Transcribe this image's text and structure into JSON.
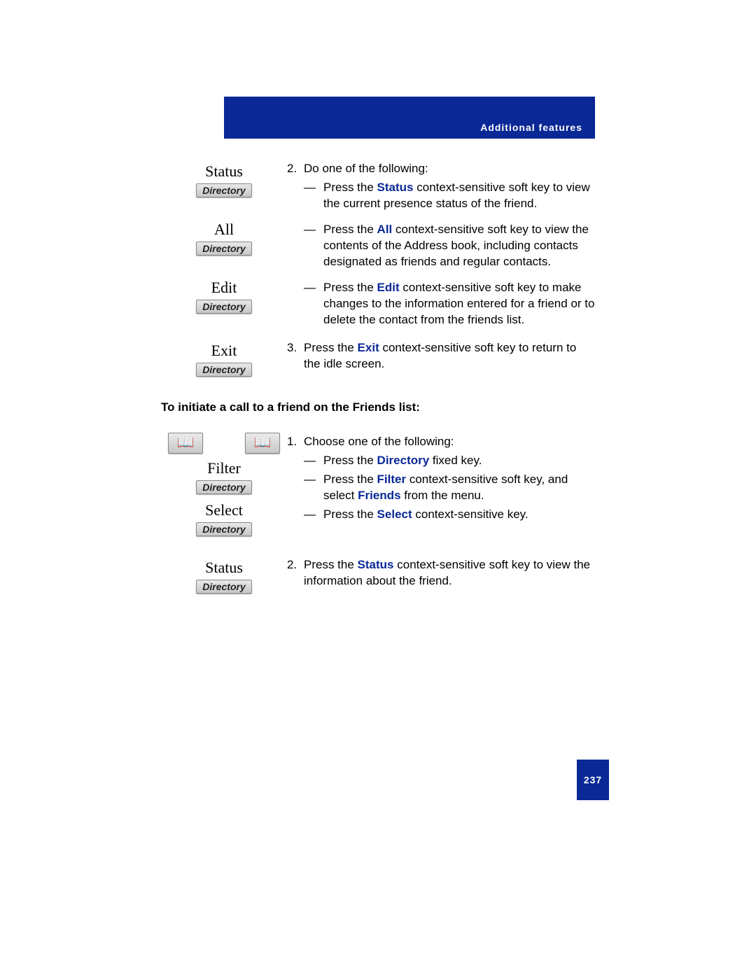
{
  "header": {
    "title": "Additional features"
  },
  "directory_label": "Directory",
  "book_glyph": "📖",
  "sec1": {
    "keys": {
      "status": "Status",
      "all": "All",
      "edit": "Edit",
      "exit": "Exit"
    },
    "step2": {
      "num": "2.",
      "lead": "Do one of the following:",
      "dash": "—",
      "status": {
        "pre": "Press the ",
        "bold": "Status",
        "post": " context-sensitive soft key to view the current presence status of the friend."
      },
      "all": {
        "pre": "Press the ",
        "bold": "All",
        "post": " context-sensitive soft key to view the contents of the Address book, including contacts designated as friends and regular contacts."
      },
      "edit": {
        "pre": "Press the ",
        "bold": "Edit",
        "post": " context-sensitive soft key to make changes to the information entered for a friend or to delete the contact from the friends list."
      }
    },
    "step3": {
      "num": "3.",
      "pre": "Press the ",
      "bold": "Exit",
      "post": " context-sensitive soft key to return to the idle screen."
    }
  },
  "heading": "To initiate a call to a friend on the Friends list:",
  "sec2": {
    "keys": {
      "filter": "Filter",
      "select": "Select",
      "status": "Status"
    },
    "step1": {
      "num": "1.",
      "lead": "Choose one of the following:",
      "dash": "—",
      "dir": {
        "pre": "Press the ",
        "bold": "Directory",
        "post": " fixed key."
      },
      "filter": {
        "pre": "Press the ",
        "bold": "Filter",
        "mid": " context-sensitive soft key, and select ",
        "bold2": "Friends",
        "post": " from the menu."
      },
      "select": {
        "pre": "Press the ",
        "bold": "Select",
        "post": " context-sensitive key."
      }
    },
    "step2": {
      "num": "2.",
      "pre": "Press the ",
      "bold": "Status",
      "post": " context-sensitive soft key to view the information about the friend."
    }
  },
  "page_number": "237"
}
